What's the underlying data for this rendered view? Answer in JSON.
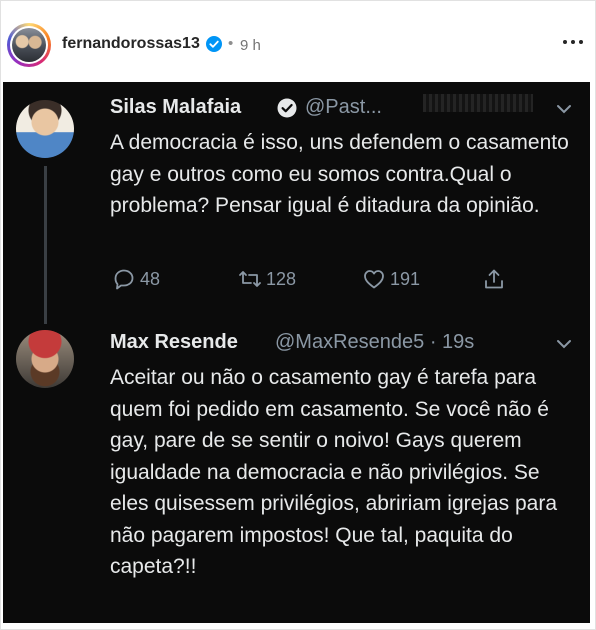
{
  "post": {
    "username": "fernandorossas13",
    "separator": "•",
    "time": "9 h",
    "more_icon": "more-horizontal-icon",
    "verified_icon": "verified-badge-icon"
  },
  "tweets": [
    {
      "name": "Silas Malafaia",
      "handle": "@Past...",
      "verified": true,
      "text": "A democracia é isso, uns defendem o casamento gay e outros como eu somos contra.Qual o problema? Pensar igual é ditadura da opinião.",
      "replies": "48",
      "retweets": "128",
      "likes": "191"
    },
    {
      "name": "Max Resende",
      "handle": "@MaxResende5 · 19s",
      "verified": false,
      "text": "Aceitar ou não o casamento gay é tarefa para quem foi pedido em casamento. Se você não é gay, pare de se sentir o noivo! Gays querem igualdade na democracia e não privilégios. Se eles quisessem privilégios, abririam igrejas para não pagarem impostos! Que tal, paquita do capeta?!!"
    }
  ],
  "colors": {
    "tweet_background": "#0b0b0b",
    "tweet_text": "#e7e9ea",
    "tweet_muted": "#8b98a5",
    "verified_blue": "#1d9bf0",
    "ig_verified": "#0095f6"
  }
}
